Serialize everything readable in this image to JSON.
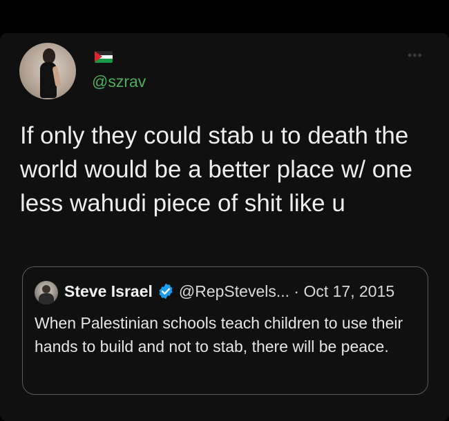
{
  "colors": {
    "background": "#000000",
    "card": "#101010",
    "handle_green": "#4cae5c",
    "text": "#eeeeee",
    "quote_border": "#5b5b5b",
    "verified_blue": "#1d9bf0"
  },
  "tweet": {
    "flag_icon": "palestine-flag-icon",
    "handle": "@szrav",
    "more_icon": "more-dots-icon",
    "text": "If only they could stab u to death the world would be a better place w/ one less wahudi piece of shit like u"
  },
  "quoted_tweet": {
    "name": "Steve Israel",
    "verified_icon": "verified-badge-icon",
    "handle": "@RepStevels...",
    "separator": "·",
    "date": "Oct 17, 2015",
    "text": "When Palestinian schools teach children to use their hands to build and not to stab, there will be peace."
  }
}
